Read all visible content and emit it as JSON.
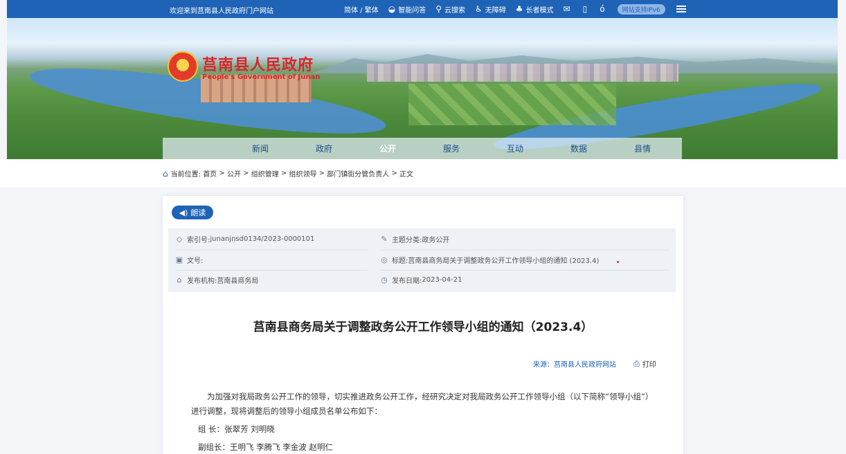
{
  "topbar": {
    "welcome": "欢迎来到莒南县人民政府门户网站",
    "tools": [
      {
        "icon": "language-icon",
        "label": "简体 / 繁体"
      },
      {
        "icon": "chat-icon",
        "label": "智能问答"
      },
      {
        "icon": "search-icon",
        "label": "云搜索"
      },
      {
        "icon": "accessibility-icon",
        "label": "无障碍"
      },
      {
        "icon": "elder-icon",
        "label": "长者模式"
      }
    ],
    "ipv6": "网站支持IPv6"
  },
  "banner": {
    "title_cn": "莒南县人民政府",
    "title_en": "People's Government of Junan"
  },
  "nav": [
    "新闻",
    "政府",
    "公开",
    "服务",
    "互动",
    "数据",
    "县情"
  ],
  "breadcrumb": {
    "prefix": "当前位置:",
    "items": [
      "首页",
      "公开",
      "组织管理",
      "组织领导",
      "部门镇街分管负责人",
      "正文"
    ],
    "sep": ">"
  },
  "article": {
    "read_label": "朗读",
    "meta": {
      "index_label": "索引号:",
      "index_value": "junanjnsd0134/2023-0000101",
      "theme_label": "主题分类:",
      "theme_value": "政务公开",
      "docno_label": "文号:",
      "docno_value": "",
      "title_label": "标题:",
      "title_value": "莒南县商务局关于调整政务公开工作领导小组的通知 (2023.4)",
      "org_label": "发布机构:",
      "org_value": "莒南县商务局",
      "date_label": "发布日期:",
      "date_value": "2023-04-21"
    },
    "title": "莒南县商务局关于调整政务公开工作领导小组的通知（2023.4）",
    "source": "来源：莒南县人民政府网站",
    "print_label": "打印",
    "para1": "为加强对我局政务公开工作的领导，切实推进政务公开工作，经研究决定对我局政务公开工作领导小组（以下简称“领导小组”）进行调整，现将调整后的领导小组成员名单公布如下：",
    "leader": "组  长：张翠芳 刘明晓",
    "deputy": "副组长：王明飞 李腾飞 李金波 赵明仁"
  }
}
